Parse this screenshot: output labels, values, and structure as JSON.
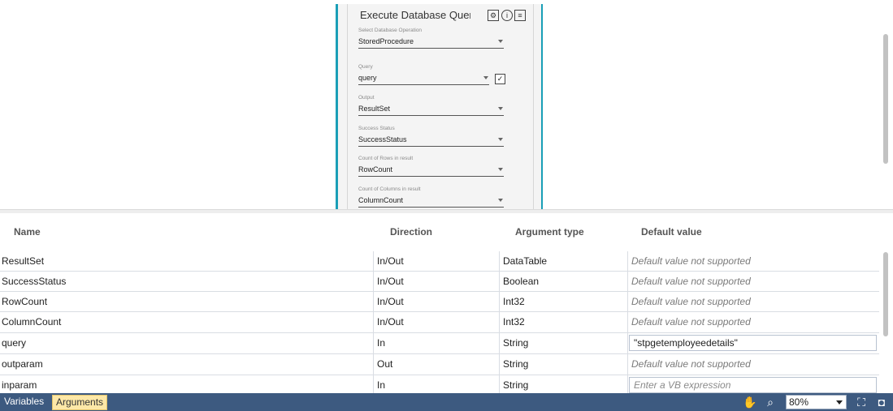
{
  "activity": {
    "title": "Execute Database Query",
    "fields": {
      "operation": {
        "label": "Select Database Operation",
        "value": "StoredProcedure"
      },
      "query": {
        "label": "Query",
        "value": "query"
      },
      "output": {
        "label": "Output",
        "value": "ResultSet"
      },
      "success": {
        "label": "Success Status",
        "value": "SuccessStatus"
      },
      "rows": {
        "label": "Count of Rows in result",
        "value": "RowCount"
      },
      "columns": {
        "label": "Count of Columns in result",
        "value": "ColumnCount"
      }
    },
    "icons": [
      "settings-icon",
      "info-icon",
      "comment-icon"
    ]
  },
  "arguments": {
    "headers": {
      "name": "Name",
      "direction": "Direction",
      "type": "Argument type",
      "default": "Default value"
    },
    "rows": [
      {
        "name": "ResultSet",
        "direction": "In/Out",
        "type": "DataTable",
        "default": "Default value not supported"
      },
      {
        "name": "SuccessStatus",
        "direction": "In/Out",
        "type": "Boolean",
        "default": "Default value not supported"
      },
      {
        "name": "RowCount",
        "direction": "In/Out",
        "type": "Int32",
        "default": "Default value not supported"
      },
      {
        "name": "ColumnCount",
        "direction": "In/Out",
        "type": "Int32",
        "default": "Default value not supported"
      },
      {
        "name": "query",
        "direction": "In",
        "type": "String",
        "default": "\"stpgetemployeedetails\""
      },
      {
        "name": "outparam",
        "direction": "Out",
        "type": "String",
        "default": "Default value not supported"
      },
      {
        "name": "inparam",
        "direction": "In",
        "type": "String",
        "default": "Enter a VB expression"
      }
    ]
  },
  "statusbar": {
    "variables": "Variables",
    "arguments": "Arguments",
    "zoom": "80%",
    "icons": [
      "hand-pan-icon",
      "search-icon",
      "fit-to-screen-icon",
      "overview-icon"
    ]
  },
  "colors": {
    "accent": "#1a9fb7",
    "statusbar": "#3d5a80",
    "active_tab": "#fde8a7"
  }
}
